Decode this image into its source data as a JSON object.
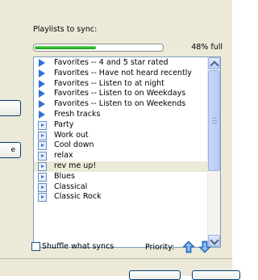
{
  "panel": {
    "label": "Playlists to sync:",
    "progress": {
      "percent": 48,
      "label": "48% full"
    },
    "items": [
      {
        "label": "Favorites -- 4 and 5 star rated",
        "icon": "auto-playlist-icon"
      },
      {
        "label": "Favorites -- Have not heard recently",
        "icon": "auto-playlist-icon"
      },
      {
        "label": "Favorites -- Listen to at night",
        "icon": "auto-playlist-icon"
      },
      {
        "label": "Favorites -- Listen to on Weekdays",
        "icon": "auto-playlist-icon"
      },
      {
        "label": "Favorites -- Listen to on Weekends",
        "icon": "auto-playlist-icon"
      },
      {
        "label": "Fresh tracks",
        "icon": "auto-playlist-icon"
      },
      {
        "label": "Party",
        "icon": "playlist-icon"
      },
      {
        "label": "Work out",
        "icon": "playlist-icon"
      },
      {
        "label": "Cool down",
        "icon": "playlist-icon"
      },
      {
        "label": "relax",
        "icon": "playlist-icon"
      },
      {
        "label": "rev me up!",
        "icon": "playlist-icon",
        "selected": true
      },
      {
        "label": "Blues",
        "icon": "playlist-icon"
      },
      {
        "label": "Classical",
        "icon": "playlist-icon"
      },
      {
        "label": "Classic Rock",
        "icon": "playlist-icon"
      }
    ],
    "shuffle_label": "Shuffle what syncs",
    "shuffle_checked": false,
    "priority_label": "Priority:"
  },
  "side": {
    "button2_fragment": "e"
  }
}
